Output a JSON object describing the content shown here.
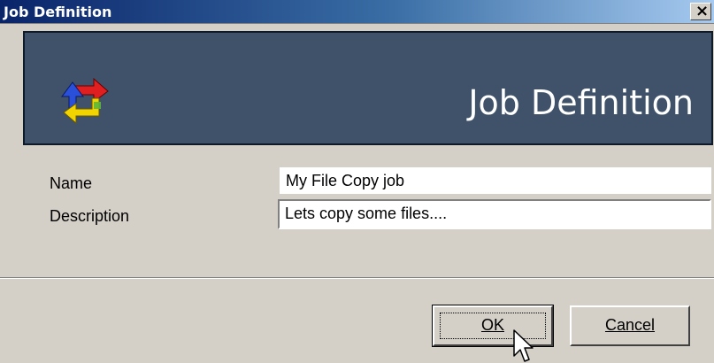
{
  "window": {
    "title": "Job Definition"
  },
  "banner": {
    "title": "Job Definition",
    "icon": "recycle-arrows-icon"
  },
  "form": {
    "name_label": "Name",
    "name_value": "My File Copy job",
    "description_label": "Description",
    "description_value": "Lets copy some files...."
  },
  "buttons": {
    "ok_label": "OK",
    "cancel_label": "Cancel"
  },
  "icons": {
    "close": "close-icon",
    "cursor": "mouse-pointer-icon"
  },
  "colors": {
    "banner_bg": "#3f5269",
    "dialog_bg": "#d4d0c8",
    "titlebar_start": "#0a246a",
    "titlebar_end": "#a6caf0"
  }
}
